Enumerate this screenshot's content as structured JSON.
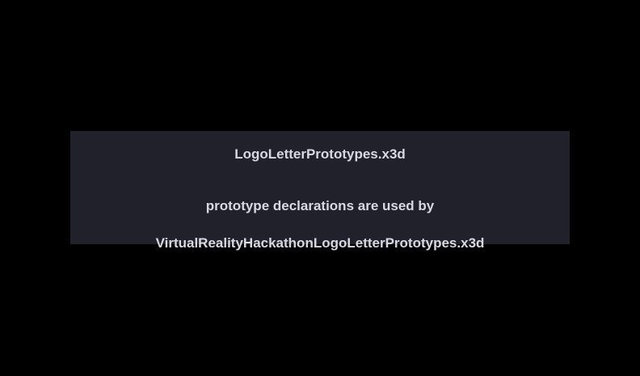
{
  "scene": {
    "title": "LogoLetterPrototypes.x3d",
    "description": "prototype declarations are used by",
    "used_by_file": "VirtualRealityHackathonLogoLetterPrototypes.x3d"
  },
  "colors": {
    "background": "#000000",
    "panel": "#21212c",
    "text": "#d8d8e2"
  }
}
